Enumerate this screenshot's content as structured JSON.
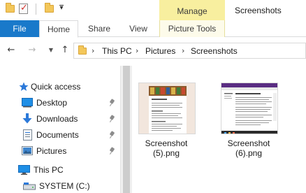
{
  "titlebar": {
    "manage_label": "Manage",
    "window_title": "Screenshots"
  },
  "ribbon": {
    "tabs": [
      {
        "label": "File"
      },
      {
        "label": "Home"
      },
      {
        "label": "Share"
      },
      {
        "label": "View"
      },
      {
        "label": "Picture Tools"
      }
    ]
  },
  "address": {
    "crumbs": [
      "This PC",
      "Pictures",
      "Screenshots"
    ]
  },
  "navpane": {
    "items": [
      {
        "label": "Quick access",
        "icon": "star-icon"
      },
      {
        "label": "Desktop",
        "icon": "desktop-folder-icon",
        "pinned": true
      },
      {
        "label": "Downloads",
        "icon": "download-arrow-icon",
        "pinned": true
      },
      {
        "label": "Documents",
        "icon": "documents-icon",
        "pinned": true
      },
      {
        "label": "Pictures",
        "icon": "pictures-icon",
        "pinned": true
      },
      {
        "label": "This PC",
        "icon": "computer-icon"
      },
      {
        "label": "SYSTEM (C:)",
        "icon": "drive-icon"
      }
    ]
  },
  "files": [
    {
      "name_line1": "Screenshot",
      "name_line2": "(5).png"
    },
    {
      "name_line1": "Screenshot",
      "name_line2": "(6).png"
    }
  ],
  "colors": {
    "accent": "#1979ca",
    "manage_tab": "#f8ef9f",
    "quick_access_star": "#2b79d9"
  }
}
